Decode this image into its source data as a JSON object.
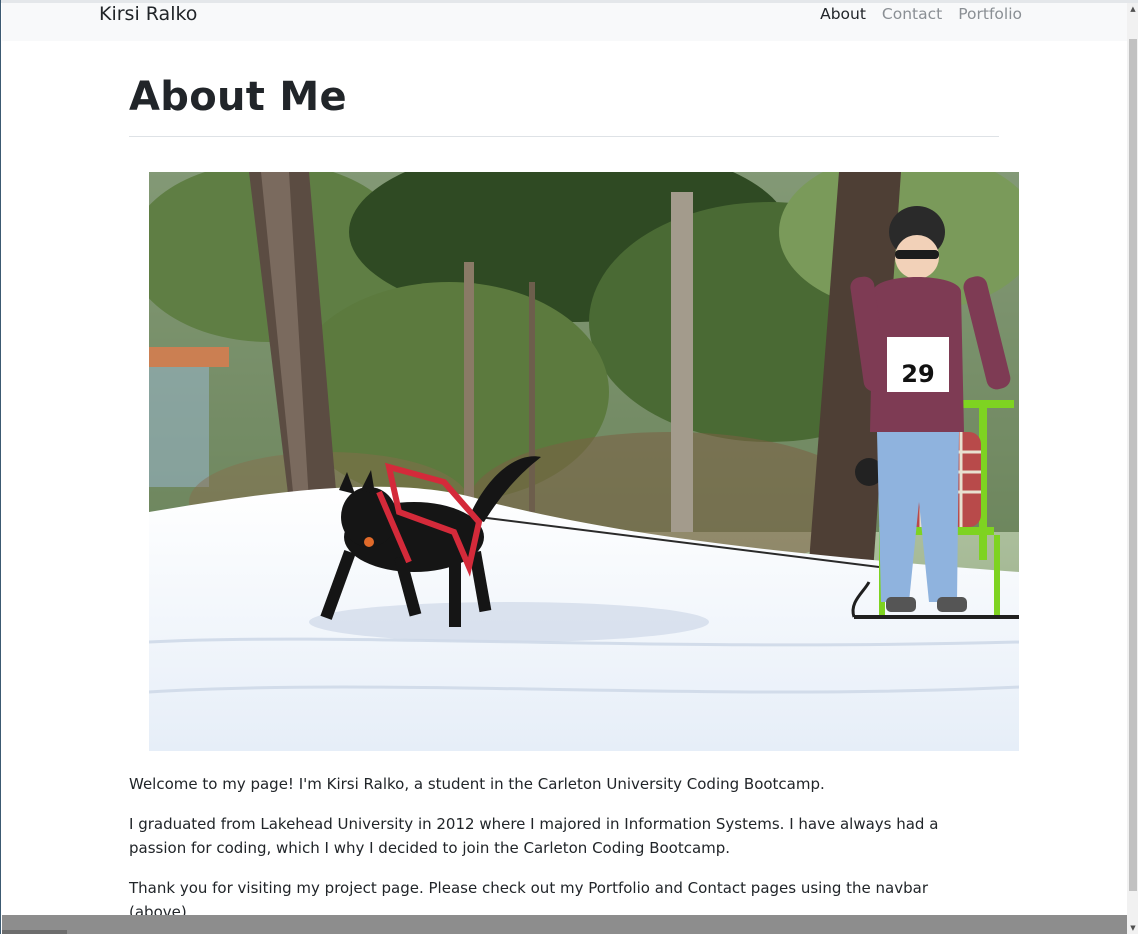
{
  "navbar": {
    "brand": "Kirsi Ralko",
    "links": [
      {
        "label": "About",
        "active": true
      },
      {
        "label": "Contact",
        "active": false
      },
      {
        "label": "Portfolio",
        "active": false
      }
    ]
  },
  "main": {
    "title": "About Me",
    "photo_description": "Photo of a person on a green kicksled pulled by a black dog in a red harness on a snowy forest trail, race bib 29",
    "bib_number": "29",
    "paragraphs": [
      "Welcome to my page! I'm Kirsi Ralko, a student in the Carleton University Coding Bootcamp.",
      "I graduated from Lakehead University in 2012 where I majored in Information Systems. I have always had a passion for coding, which I why I decided to join the Carleton Coding Bootcamp.",
      "Thank you for visiting my project page. Please check out my Portfolio and Contact pages using the navbar (above)."
    ]
  },
  "colors": {
    "navbar_bg": "#f8f9fa",
    "text": "#212529",
    "nav_inactive": "#8a8f94",
    "harness": "#d42a3a",
    "sled": "#7ed321"
  },
  "icons": {
    "scroll_up": "scroll-up-arrow-icon",
    "scroll_down": "scroll-down-arrow-icon"
  }
}
